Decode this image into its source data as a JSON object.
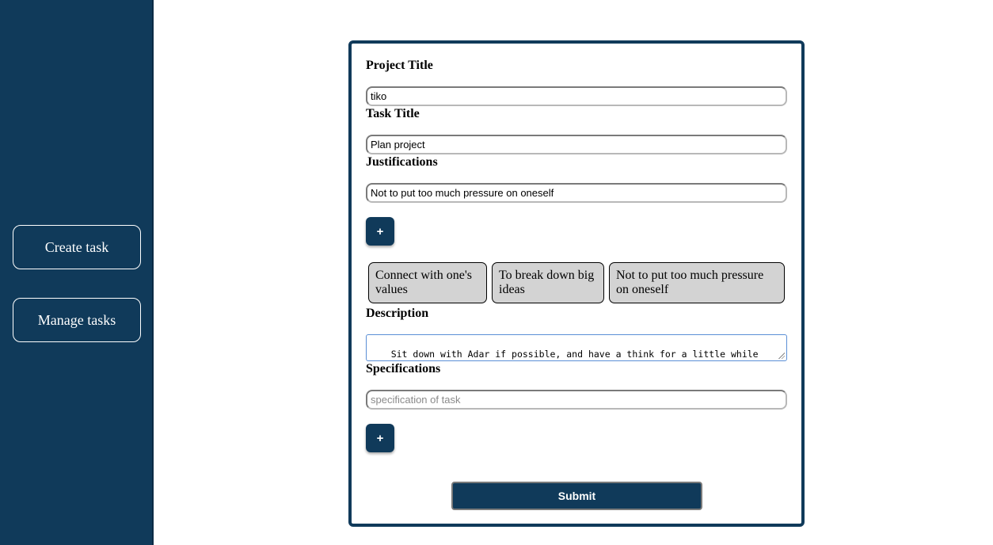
{
  "sidebar": {
    "items": [
      {
        "label": "Create task"
      },
      {
        "label": "Manage tasks"
      }
    ]
  },
  "form": {
    "project_title": {
      "label": "Project Title",
      "value": "tiko"
    },
    "task_title": {
      "label": "Task Title",
      "value": "Plan project"
    },
    "justifications": {
      "label": "Justifications",
      "value": "Not to put too much pressure on oneself",
      "add_label": "+",
      "chips": [
        "Connect with one's values",
        "To break down big ideas",
        "Not to put too much pressure on oneself"
      ]
    },
    "description": {
      "label": "Description",
      "value": "Sit down with Adar if possible, and have a think for a little while because it could be something which is very good."
    },
    "specifications": {
      "label": "Specifications",
      "placeholder": "specification of task",
      "add_label": "+"
    },
    "submit_label": "Submit"
  },
  "colors": {
    "primary": "#103a5a",
    "chip_bg": "#d3d3d3",
    "focus_border": "#5b8fd6"
  }
}
